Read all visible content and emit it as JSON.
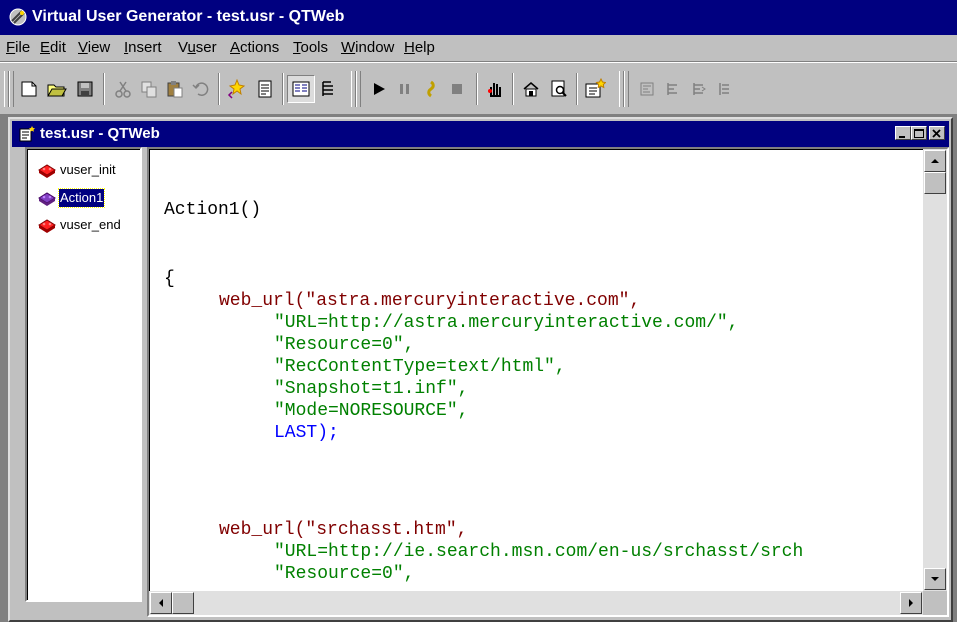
{
  "app": {
    "title": "Virtual User Generator - test.usr - QTWeb"
  },
  "menu": {
    "items": [
      {
        "label": "File",
        "accel": "F"
      },
      {
        "label": "Edit",
        "accel": "E"
      },
      {
        "label": "View",
        "accel": "V"
      },
      {
        "label": "Insert",
        "accel": "I"
      },
      {
        "label": "Vuser",
        "accel": "u"
      },
      {
        "label": "Actions",
        "accel": "A"
      },
      {
        "label": "Tools",
        "accel": "T"
      },
      {
        "label": "Window",
        "accel": "W"
      },
      {
        "label": "Help",
        "accel": "H"
      }
    ]
  },
  "toolbar": {
    "buttons": [
      "new-icon",
      "open-icon",
      "save-icon",
      "cut-icon",
      "copy-icon",
      "paste-icon",
      "undo-icon",
      "new-action-icon",
      "script-view-icon",
      "tree-view-icon",
      "grid-view-icon",
      "run-icon",
      "pause-icon",
      "step-icon",
      "stop-icon",
      "breakpoint-icon",
      "run-time-settings-icon",
      "browse-icon",
      "record-icon",
      "align-left-icon",
      "align-center-icon",
      "align-right-icon",
      "align-justify-icon"
    ]
  },
  "child_window": {
    "title": "test.usr - QTWeb"
  },
  "tree": {
    "items": [
      {
        "label": "vuser_init",
        "selected": false
      },
      {
        "label": "Action1",
        "selected": true
      },
      {
        "label": "vuser_end",
        "selected": false
      }
    ]
  },
  "code": {
    "lines": [
      {
        "text": "Action1()",
        "indent": 0,
        "color": "black"
      },
      {
        "text": "{",
        "indent": 0,
        "color": "black"
      },
      {
        "text": "web_url(\"astra.mercuryinteractive.com\",",
        "indent": 4,
        "color": "red"
      },
      {
        "text": "\"URL=http://astra.mercuryinteractive.com/\",",
        "indent": 8,
        "color": "green"
      },
      {
        "text": "\"Resource=0\",",
        "indent": 8,
        "color": "green"
      },
      {
        "text": "\"RecContentType=text/html\",",
        "indent": 8,
        "color": "green"
      },
      {
        "text": "\"Snapshot=t1.inf\",",
        "indent": 8,
        "color": "green"
      },
      {
        "text": "\"Mode=NORESOURCE\",",
        "indent": 8,
        "color": "green"
      },
      {
        "text": "LAST);",
        "indent": 8,
        "color": "blue"
      },
      {
        "text": "web_url(\"srchasst.htm\",",
        "indent": 4,
        "color": "red"
      },
      {
        "text": "\"URL=http://ie.search.msn.com/en-us/srchasst/srch",
        "indent": 8,
        "color": "green"
      },
      {
        "text": "\"Resource=0\",",
        "indent": 8,
        "color": "green"
      }
    ]
  }
}
